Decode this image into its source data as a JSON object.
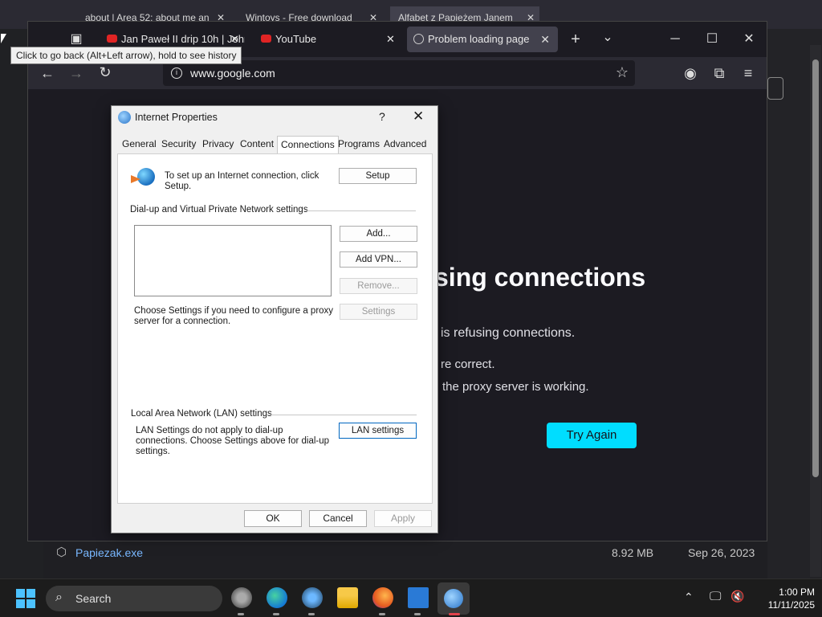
{
  "background_window": {
    "tabs": [
      {
        "label": "about | Area 52: about me an",
        "close": "✕"
      },
      {
        "label": "Wintoys - Free download",
        "close": "✕"
      },
      {
        "label": "Alfabet z Papieżem Janem",
        "close": "✕"
      }
    ],
    "file_row": {
      "name": "Papiezak.exe",
      "size": "8.92 MB",
      "date": "Sep 26, 2023"
    }
  },
  "browser": {
    "tabs": [
      {
        "label": "Jan Paweł II drip 10h | John",
        "close": "✕"
      },
      {
        "label": "YouTube",
        "close": "✕"
      },
      {
        "label": "Problem loading page",
        "close": "✕"
      }
    ],
    "new_tab": "+",
    "tab_list": "⌄",
    "window_controls": {
      "minimize": "─",
      "maximize": "☐",
      "close": "✕"
    },
    "url": "www.google.com",
    "tooltip": "Click to go back (Alt+Left arrow), hold to see history",
    "error": {
      "title_visible": "sing connections",
      "line1_visible": "is refusing connections.",
      "line2_visible": "re correct.",
      "line3_visible": "the proxy server is working.",
      "try_again": "Try Again"
    }
  },
  "dialog": {
    "title": "Internet Properties",
    "help": "?",
    "close": "✕",
    "tabs": [
      "General",
      "Security",
      "Privacy",
      "Content",
      "Connections",
      "Programs",
      "Advanced"
    ],
    "active_tab": "Connections",
    "setup_text": "To set up an Internet connection, click Setup.",
    "setup_button": "Setup",
    "dialup_section": "Dial-up and Virtual Private Network settings",
    "add_button": "Add...",
    "add_vpn_button": "Add VPN...",
    "remove_button": "Remove...",
    "settings_button": "Settings",
    "proxy_text": "Choose Settings if you need to configure a proxy server for a connection.",
    "lan_section": "Local Area Network (LAN) settings",
    "lan_text": "LAN Settings do not apply to dial-up connections. Choose Settings above for dial-up settings.",
    "lan_button": "LAN settings",
    "ok": "OK",
    "cancel": "Cancel",
    "apply": "Apply"
  },
  "taskbar": {
    "search_label": "Search",
    "time": "1:00 PM",
    "date": "11/11/2025"
  },
  "colors": {
    "accent_cyan": "#00ddff",
    "windows_blue": "#4cc2ff",
    "youtube_red": "#e02424"
  }
}
